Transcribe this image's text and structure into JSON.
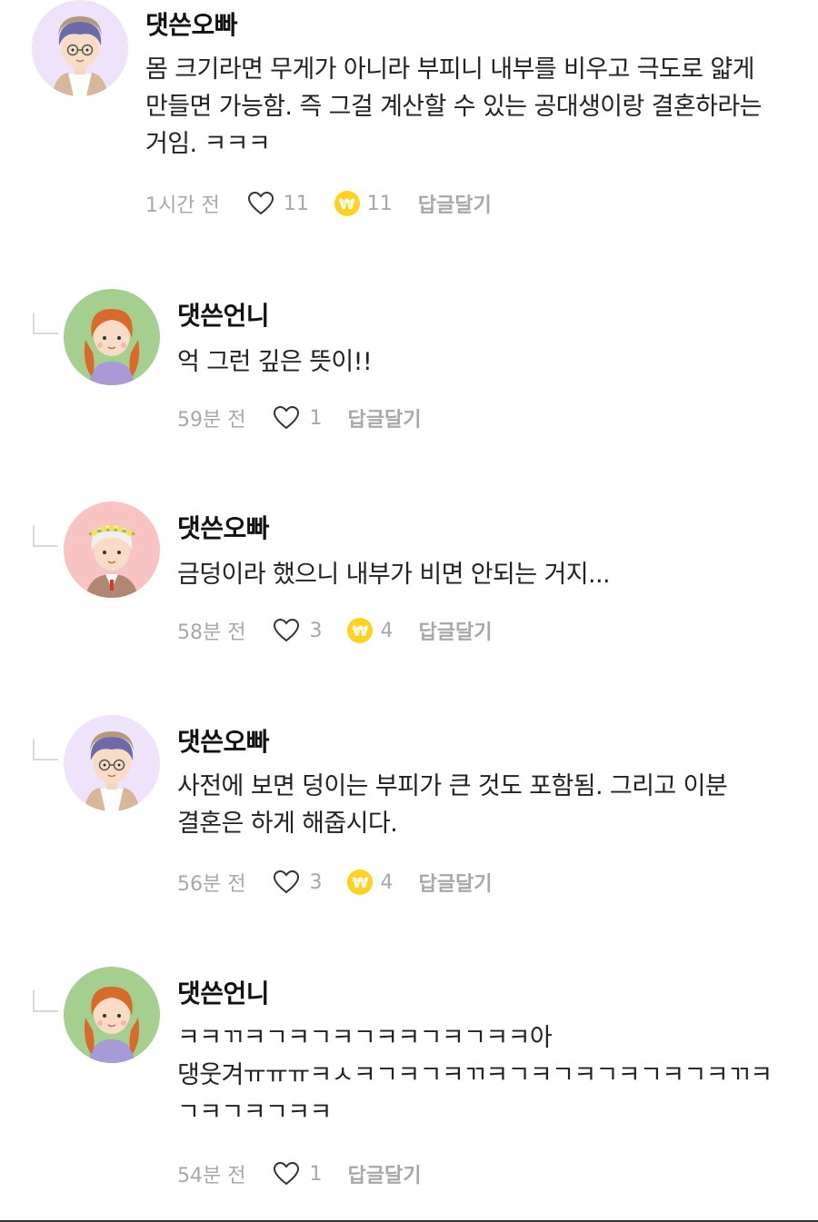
{
  "comments": [
    {
      "author": "댓쓴오빠",
      "avatar": "boy-glasses-avatar",
      "text": "몸 크기라면 무게가 아니라 부피니 내부를 비우고 극도로 얇게 만들면 가능함. 즉 그걸 계산할 수 있는 공대생이랑 결혼하라는 거임. ㅋㅋㅋ",
      "time": "1시간 전",
      "likes": "11",
      "coins": "11",
      "reply_label": "답글달기"
    },
    {
      "author": "댓쓴언니",
      "avatar": "girl-braids-avatar",
      "text": "억 그런 깊은 뜻이!!",
      "time": "59분 전",
      "likes": "1",
      "reply_label": "답글달기"
    },
    {
      "author": "댓쓴오빠",
      "avatar": "boy-flower-crown-avatar",
      "text": "금덩이라 했으니 내부가 비면 안되는 거지...",
      "time": "58분 전",
      "likes": "3",
      "coins": "4",
      "reply_label": "답글달기"
    },
    {
      "author": "댓쓴오빠",
      "avatar": "boy-glasses-avatar",
      "text": "사전에 보면 덩이는 부피가 큰 것도 포함됨. 그리고 이분 결혼은 하게 해줍시다.",
      "time": "56분 전",
      "likes": "3",
      "coins": "4",
      "reply_label": "답글달기"
    },
    {
      "author": "댓쓴언니",
      "avatar": "girl-braids-avatar",
      "text": "ㅋㅋㄲㅋㄱㅋㄱㅋㄱㅋㅋㄱㅋㄱㅋㅋ아 댕웃겨ㅠㅠㅠㅋㅅㅋㄱㅋㄱㅋㄲㅋㄱㅋㄱㅋㄱㅋㄱㅋㄱㅋㄲㅋㄱㅋㄱㅋㄱㅋㅋ",
      "time": "54분 전",
      "likes": "1",
      "reply_label": "답글달기"
    }
  ],
  "coin_symbol": "₩",
  "colors": {
    "coin": "#ffd21f",
    "meta_gray": "#a8a8a8",
    "avatar_purple_bg": "#efe3fb",
    "avatar_green_bg": "#a4cf8e",
    "avatar_pink_bg": "#f7c3c3"
  }
}
